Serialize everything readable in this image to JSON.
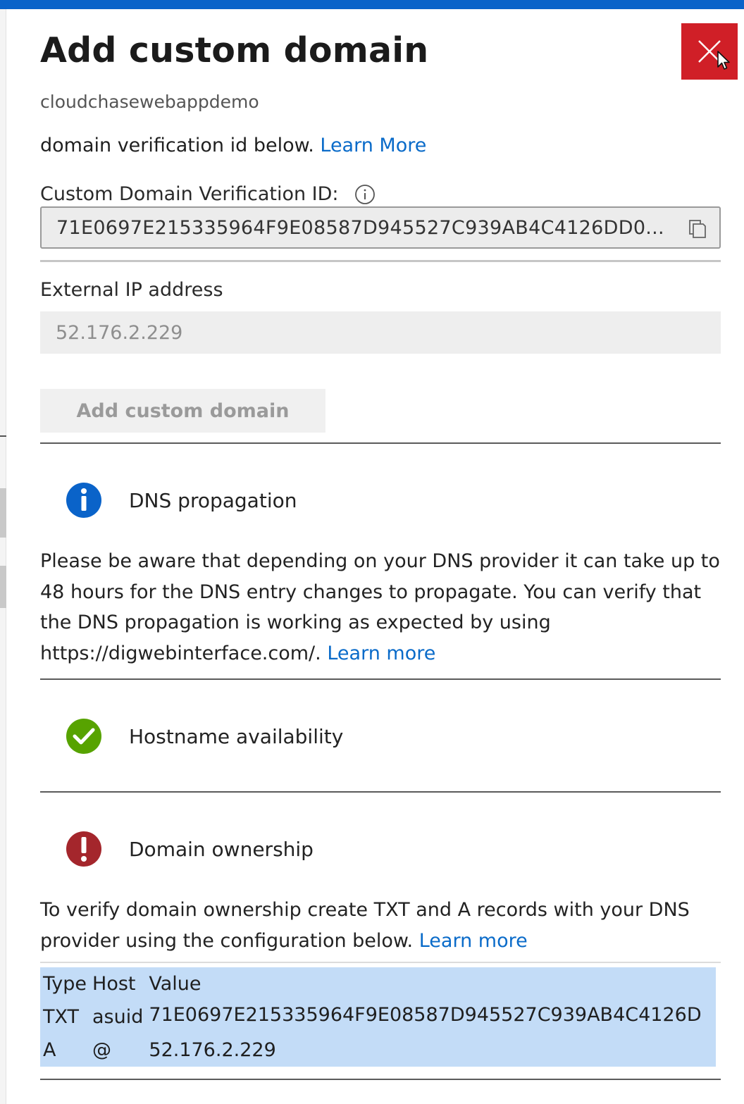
{
  "blade": {
    "title": "Add custom domain",
    "subtitle": "cloudchasewebappdemo",
    "close_icon": "close-icon"
  },
  "intro": {
    "text": "domain verification id below.",
    "link": "Learn More"
  },
  "verification": {
    "label": "Custom Domain Verification ID:",
    "info_icon": "info-icon",
    "value": "71E0697E215335964F9E08587D945527C939AB4C4126DD0...",
    "copy_icon": "copy-icon"
  },
  "external_ip": {
    "label": "External IP address",
    "value": "52.176.2.229"
  },
  "add_button": {
    "label": "Add custom domain"
  },
  "dns_propagation": {
    "icon": "info-filled-icon",
    "title": "DNS propagation",
    "text": "Please be aware that depending on your DNS provider it can take up to 48 hours for the DNS entry changes to propagate. You can verify that the DNS propagation is working as expected by using https://digwebinterface.com/.",
    "link": "Learn more"
  },
  "hostname_availability": {
    "icon": "success-check-icon",
    "title": "Hostname availability"
  },
  "domain_ownership": {
    "icon": "error-exclamation-icon",
    "title": "Domain ownership",
    "text": "To verify domain ownership create TXT and A records with your DNS provider using the configuration below.",
    "link": "Learn more"
  },
  "records_table": {
    "headers": [
      "Type",
      "Host",
      "Value"
    ],
    "rows": [
      [
        "TXT",
        "asuid",
        "71E0697E215335964F9E08587D945527C939AB4C4126D"
      ],
      [
        "A",
        "@",
        "52.176.2.229"
      ]
    ]
  },
  "colors": {
    "accent": "#0a63c9",
    "link": "#0a6bc9",
    "close": "#d01f27",
    "success": "#57a300",
    "error": "#a4262c",
    "selection": "#c3dcf7"
  }
}
